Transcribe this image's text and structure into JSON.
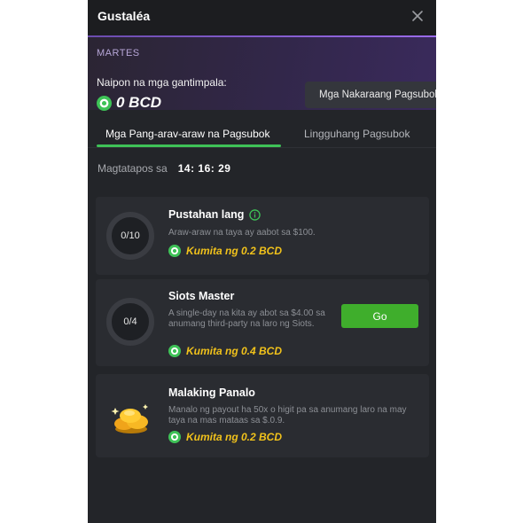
{
  "header": {
    "title": "Gustaléa"
  },
  "banner": {
    "day": "MARTES",
    "accumulated_label": "Naipon na mga gantimpala:",
    "accumulated_value": "0 BCD",
    "previous_button": "Mga Nakaraang Pagsubok"
  },
  "tabs": [
    {
      "label": "Mga Pang-arav-araw na Pagsubok",
      "active": true
    },
    {
      "label": "Lingguhang Pagsubok",
      "active": false
    }
  ],
  "timer": {
    "label": "Magtatapos sa",
    "value": "14: 16: 29"
  },
  "quests": [
    {
      "progress": "0/10",
      "title": "Pustahan lang",
      "description": "Araw-araw na taya ay aabot sa $100.",
      "reward": "Kumita ng 0.2 BCD"
    },
    {
      "progress": "0/4",
      "title": "Siots Master",
      "description": "A single-day na kita ay abot sa $4.00 sa anumang third-party na laro ng Siots.",
      "reward": "Kumita ng 0.4 BCD",
      "button": "Go"
    },
    {
      "title": "Malaking Panalo",
      "description": "Manalo ng payout ha 50x o higit pa sa anumang laro na may taya na mas mataas sa $.0.9.",
      "reward": "Kumita ng 0.2 BCD"
    }
  ],
  "colors": {
    "accent_green": "#3ec257",
    "reward_gold": "#f1c21b",
    "go_button": "#3fae2c"
  },
  "icons": {
    "close": "close-icon",
    "coin": "bcd-coin-icon",
    "info": "info-icon",
    "trophy": "gold-coins-icon"
  }
}
